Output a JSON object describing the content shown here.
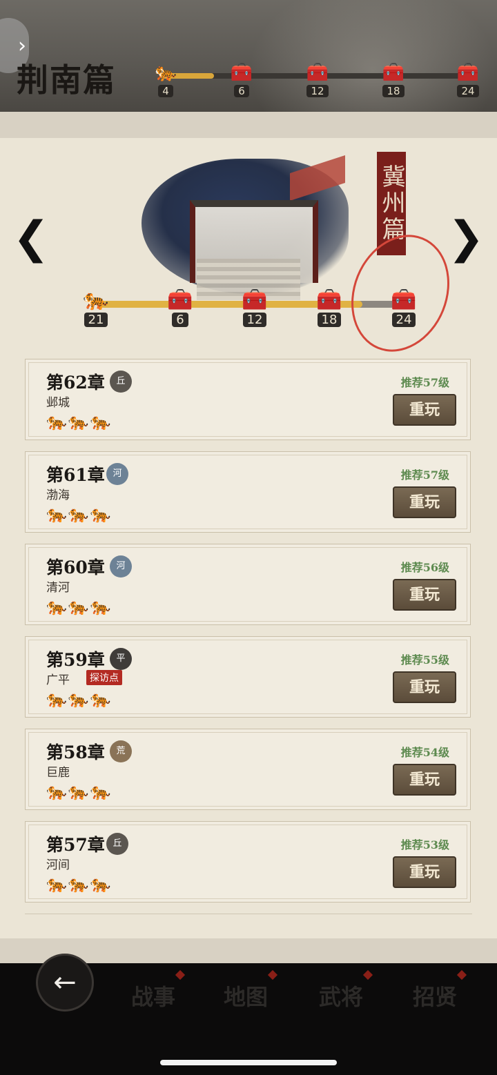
{
  "top_banner": {
    "title": "荆南篇",
    "back_glyph": "›",
    "progress": {
      "current": "4",
      "milestones": [
        "6",
        "12",
        "18",
        "24"
      ],
      "fill_fraction": 0.17
    }
  },
  "header": {
    "seal_text": "冀州篇",
    "progress": {
      "current": "21",
      "milestones": [
        "6",
        "12",
        "18",
        "24"
      ],
      "fill_fraction": 0.875
    }
  },
  "chapters": [
    {
      "title": "第62章",
      "terrain": "丘",
      "place": "邺城",
      "level": "推荐57级",
      "stars": "3",
      "badge": "",
      "replay": "重玩"
    },
    {
      "title": "第61章",
      "terrain": "河",
      "place": "渤海",
      "level": "推荐57级",
      "stars": "3",
      "badge": "",
      "replay": "重玩"
    },
    {
      "title": "第60章",
      "terrain": "河",
      "place": "清河",
      "level": "推荐56级",
      "stars": "3",
      "badge": "",
      "replay": "重玩"
    },
    {
      "title": "第59章",
      "terrain": "平",
      "place": "广平",
      "level": "推荐55级",
      "stars": "3",
      "badge": "探访点",
      "replay": "重玩"
    },
    {
      "title": "第58章",
      "terrain": "荒",
      "place": "巨鹿",
      "level": "推荐54级",
      "stars": "3",
      "badge": "",
      "replay": "重玩"
    },
    {
      "title": "第57章",
      "terrain": "丘",
      "place": "河间",
      "level": "推荐53级",
      "stars": "3",
      "badge": "",
      "replay": "重玩"
    }
  ],
  "bottom_nav": {
    "tabs": [
      "战事",
      "地图",
      "武将",
      "招贤"
    ],
    "active": "地图"
  },
  "colors": {
    "accent_gold": "#e0b243",
    "level_green": "#5d8a4f",
    "badge_red": "#b32a22",
    "seal_red": "#7a1f1b"
  },
  "icons": {
    "tiger": "tiger-icon",
    "chest": "treasure-chest-icon",
    "back": "back-arrow-icon"
  }
}
